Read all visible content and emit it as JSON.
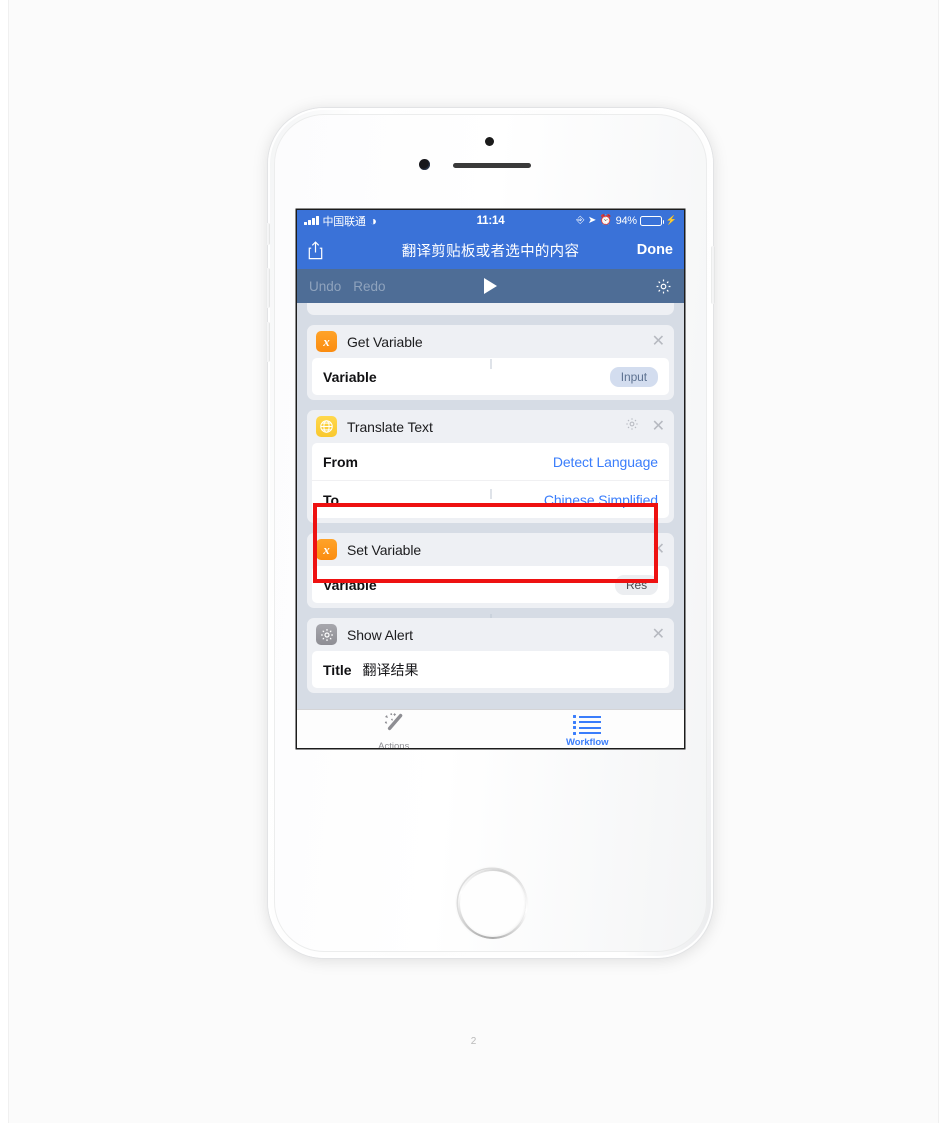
{
  "document": {
    "page_number": "2"
  },
  "status_bar": {
    "carrier": "中国联通",
    "wifi_icon": "wifi-icon",
    "time": "11:14",
    "rotation_lock_icon": "rotation-lock-icon",
    "location_icon": "location-arrow-icon",
    "alarm_icon": "alarm-clock-icon",
    "battery_percent": "94%",
    "battery_level": 94,
    "charging_icon": "charging-bolt-icon"
  },
  "nav_bar": {
    "share_icon": "share-icon",
    "title": "翻译剪贴板或者选中的内容",
    "done_label": "Done"
  },
  "toolbar": {
    "undo_label": "Undo",
    "redo_label": "Redo",
    "run_icon": "play-triangle-icon",
    "settings_icon": "gear-icon"
  },
  "workflow": {
    "actions": [
      {
        "icon": "variable-x-icon",
        "icon_color": "#fb8c10",
        "title": "Get Variable",
        "close_icon": "close-icon",
        "has_gear": false,
        "rows": [
          {
            "label": "Variable",
            "value": "Input",
            "value_type": "pill-blue"
          }
        ]
      },
      {
        "icon": "globe-icon",
        "icon_color": "#f9c82e",
        "title": "Translate Text",
        "close_icon": "close-icon",
        "has_gear": true,
        "gear_icon": "gear-icon",
        "rows": [
          {
            "label": "From",
            "value": "Detect Language",
            "value_type": "link"
          },
          {
            "label": "To",
            "value": "Chinese Simplified",
            "value_type": "link"
          }
        ]
      },
      {
        "icon": "variable-x-icon",
        "icon_color": "#fb8c10",
        "title": "Set Variable",
        "close_icon": "close-icon",
        "has_gear": false,
        "rows": [
          {
            "label": "Variable",
            "value": "Res",
            "value_type": "pill-gray"
          }
        ]
      },
      {
        "icon": "alert-gear-icon",
        "icon_color": "#8e8e94",
        "title": "Show Alert",
        "close_icon": "close-icon",
        "has_gear": false,
        "rows": [
          {
            "label": "Title",
            "value": "翻译结果",
            "value_type": "text"
          }
        ]
      }
    ],
    "highlight_color": "#ee1111"
  },
  "tab_bar": {
    "tabs": [
      {
        "label": "Actions",
        "icon": "magic-wand-icon",
        "active": false
      },
      {
        "label": "Workflow",
        "icon": "list-icon",
        "active": true
      }
    ]
  },
  "colors": {
    "nav_blue": "#3a72d8",
    "toolbar_blue": "#4e6d96",
    "link_blue": "#3a7dfb",
    "screen_bg": "#d6dce5",
    "card_bg": "#eef0f4"
  }
}
